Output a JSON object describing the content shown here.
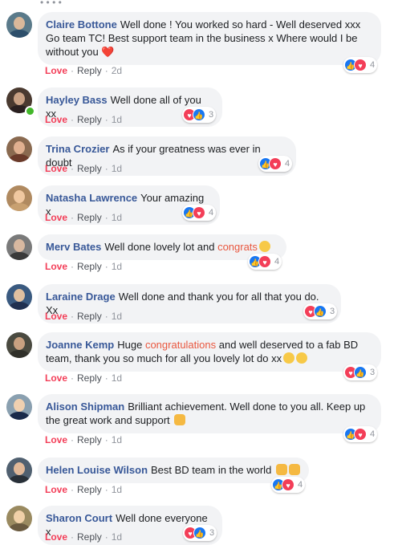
{
  "overflow_dots": "• • • •",
  "comments": [
    {
      "author": "Claire Bottone",
      "text": "Well done ! You worked so hard - Well deserved xxx Go team TC! Best support team in the business x Where would I be without you ",
      "emoji": "❤️",
      "love": "Love",
      "reply": "Reply",
      "time": "2d",
      "reactions": [
        "like",
        "love"
      ],
      "count": "4"
    },
    {
      "author": "Hayley Bass",
      "text": "Well done all of you xx",
      "love": "Love",
      "reply": "Reply",
      "time": "1d",
      "reactions": [
        "love",
        "like"
      ],
      "count": "3",
      "online": true
    },
    {
      "author": "Trina Crozier",
      "text": "As if your greatness was ever in doubt",
      "love": "Love",
      "reply": "Reply",
      "time": "1d",
      "reactions": [
        "like",
        "love"
      ],
      "count": "4"
    },
    {
      "author": "Natasha Lawrence",
      "text": "Your amazing x",
      "love": "Love",
      "reply": "Reply",
      "time": "1d",
      "reactions": [
        "like",
        "love"
      ],
      "count": "4"
    },
    {
      "author": "Merv Bates",
      "text_before": "Well done lovely lot and ",
      "highlight": "congrats",
      "love": "Love",
      "reply": "Reply",
      "time": "1d",
      "reactions": [
        "like",
        "love"
      ],
      "count": "4"
    },
    {
      "author": "Laraine Drage",
      "text": "Well done and thank you for all that you do. Xx",
      "love": "Love",
      "reply": "Reply",
      "time": "1d",
      "reactions": [
        "love",
        "like"
      ],
      "count": "3"
    },
    {
      "author": "Joanne Kemp",
      "text_before": "Huge ",
      "highlight": "congratulations",
      "text_after": " and well deserved to a fab BD team, thank you so much for all you lovely lot do xx",
      "love": "Love",
      "reply": "Reply",
      "time": "1d",
      "reactions": [
        "love",
        "like"
      ],
      "count": "3"
    },
    {
      "author": "Alison Shipman",
      "text": "Brilliant achievement. Well done to you all. Keep up the great work and support ",
      "love": "Love",
      "reply": "Reply",
      "time": "1d",
      "reactions": [
        "like",
        "love"
      ],
      "count": "4"
    },
    {
      "author": "Helen Louise Wilson",
      "text": "Best BD team in the world ",
      "love": "Love",
      "reply": "Reply",
      "time": "1d",
      "reactions": [
        "like",
        "love"
      ],
      "count": "4"
    },
    {
      "author": "Sharon Court",
      "text": "Well done everyone x",
      "love": "Love",
      "reply": "Reply",
      "time": "1d",
      "reactions": [
        "love",
        "like"
      ],
      "count": "3"
    }
  ],
  "icons": {
    "like": "thumbs-up-icon",
    "love": "heart-icon"
  },
  "colors": {
    "author": "#385898",
    "love": "#f33e58",
    "like": "#1877f2",
    "bubble": "#f2f3f5",
    "highlight": "#e9573f"
  }
}
